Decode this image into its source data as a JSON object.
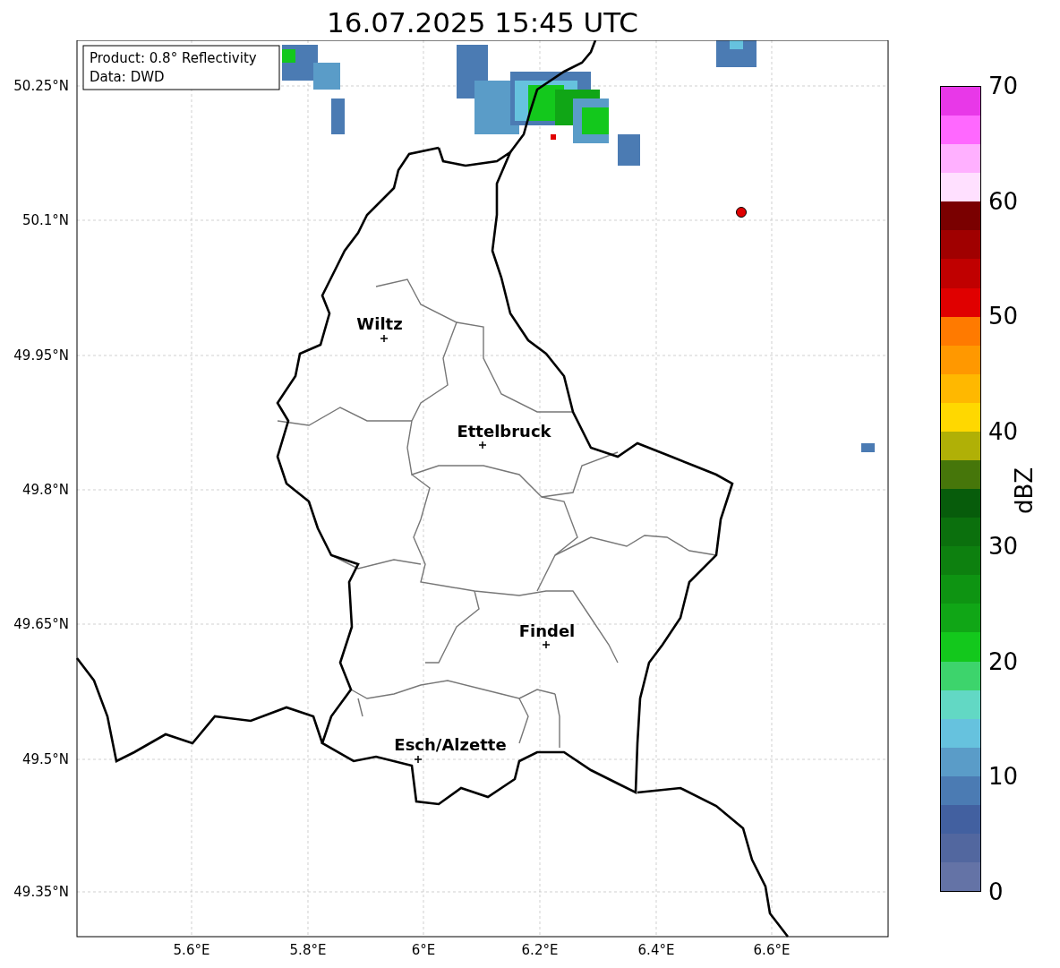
{
  "title": "16.07.2025 15:45 UTC",
  "info_box": [
    "Product: 0.8° Reflectivity",
    "Data: DWD"
  ],
  "y_ticks": [
    "50.25°N",
    "50.1°N",
    "49.95°N",
    "49.8°N",
    "49.65°N",
    "49.5°N",
    "49.35°N"
  ],
  "x_ticks": [
    "5.6°E",
    "5.8°E",
    "6°E",
    "6.2°E",
    "6.4°E",
    "6.6°E"
  ],
  "cities": [
    {
      "name": "Wiltz"
    },
    {
      "name": "Ettelbruck"
    },
    {
      "name": "Findel"
    },
    {
      "name": "Esch/Alzette"
    }
  ],
  "colorbar": {
    "label": "dBZ",
    "ticks": [
      "70",
      "60",
      "50",
      "40",
      "30",
      "20",
      "10",
      "0"
    ],
    "segments": [
      {
        "color": "#e838e8"
      },
      {
        "color": "#ff68ff"
      },
      {
        "color": "#ffb0ff"
      },
      {
        "color": "#ffe0ff"
      },
      {
        "color": "#7a0000"
      },
      {
        "color": "#a00000"
      },
      {
        "color": "#c00000"
      },
      {
        "color": "#e00000"
      },
      {
        "color": "#ff7a00"
      },
      {
        "color": "#ff9800"
      },
      {
        "color": "#ffb800"
      },
      {
        "color": "#ffd800"
      },
      {
        "color": "#b0b006"
      },
      {
        "color": "#46760a"
      },
      {
        "color": "#075c0b"
      },
      {
        "color": "#0b700d"
      },
      {
        "color": "#0d800f"
      },
      {
        "color": "#0e9412"
      },
      {
        "color": "#10a616"
      },
      {
        "color": "#13c81c"
      },
      {
        "color": "#3dd46c"
      },
      {
        "color": "#62d8c4"
      },
      {
        "color": "#66c2de"
      },
      {
        "color": "#5a9cc8"
      },
      {
        "color": "#4b7bb3"
      },
      {
        "color": "#4260a0"
      },
      {
        "color": "#52679f"
      },
      {
        "color": "#6473a6"
      }
    ]
  }
}
